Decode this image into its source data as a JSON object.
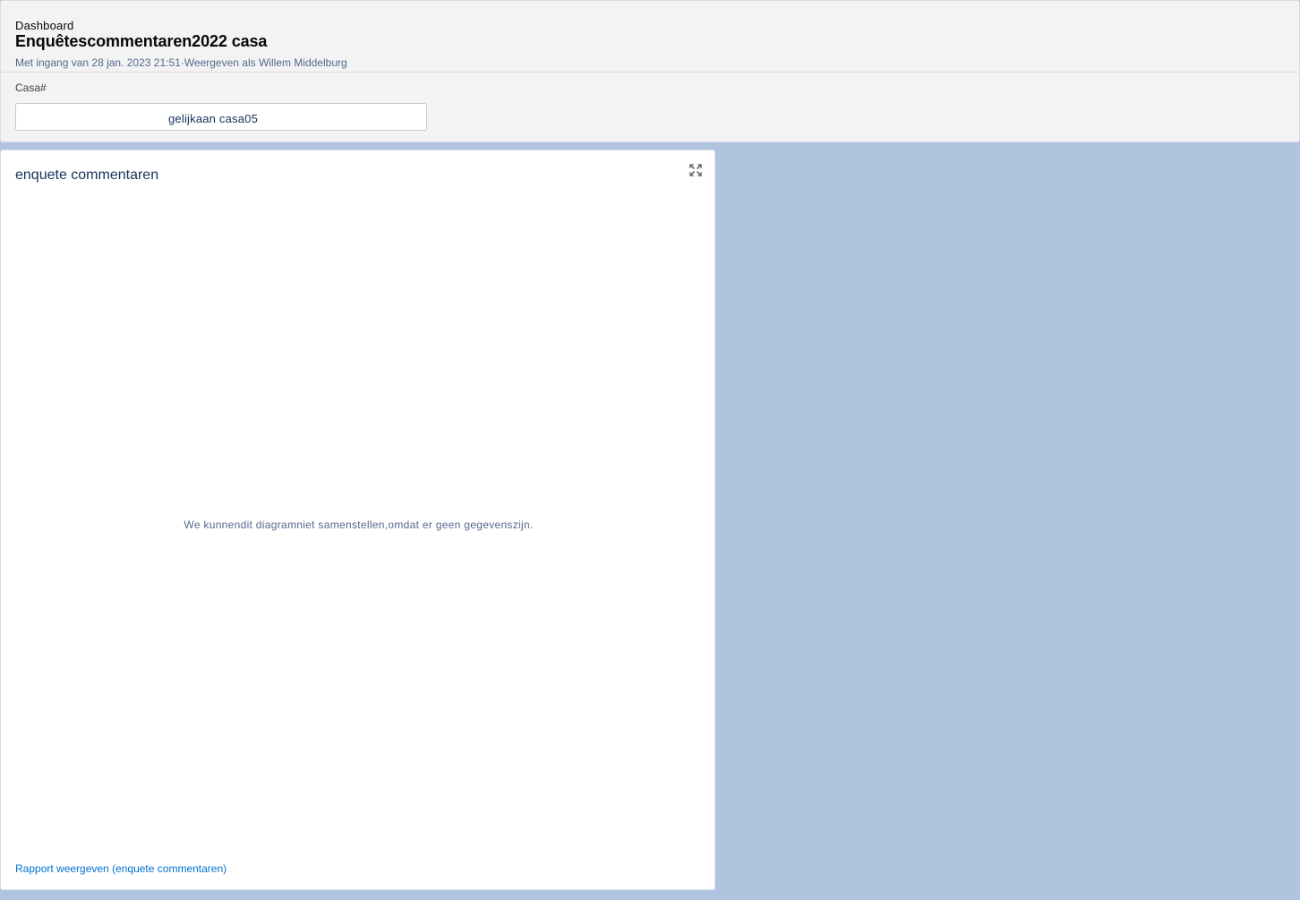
{
  "header": {
    "eyebrow": "Dashboard",
    "title": "Enquêtescommentaren2022 casa",
    "subtitle": "Met ingang van 28 jan. 2023 21:51·Weergeven als Willem Middelburg"
  },
  "filter": {
    "label": "Casa#",
    "value": "gelijkaan casa05"
  },
  "widget": {
    "title": "enquete commentaren",
    "expand_icon": "expand-icon",
    "empty_message": "We kunnendit diagramniet samenstellen,omdat er geen gegevenszijn.",
    "report_link": "Rapport weergeven (enquete commentaren)"
  },
  "colors": {
    "page_background": "#b0c4df",
    "link": "#0070d2",
    "muted_text": "#54698d"
  }
}
